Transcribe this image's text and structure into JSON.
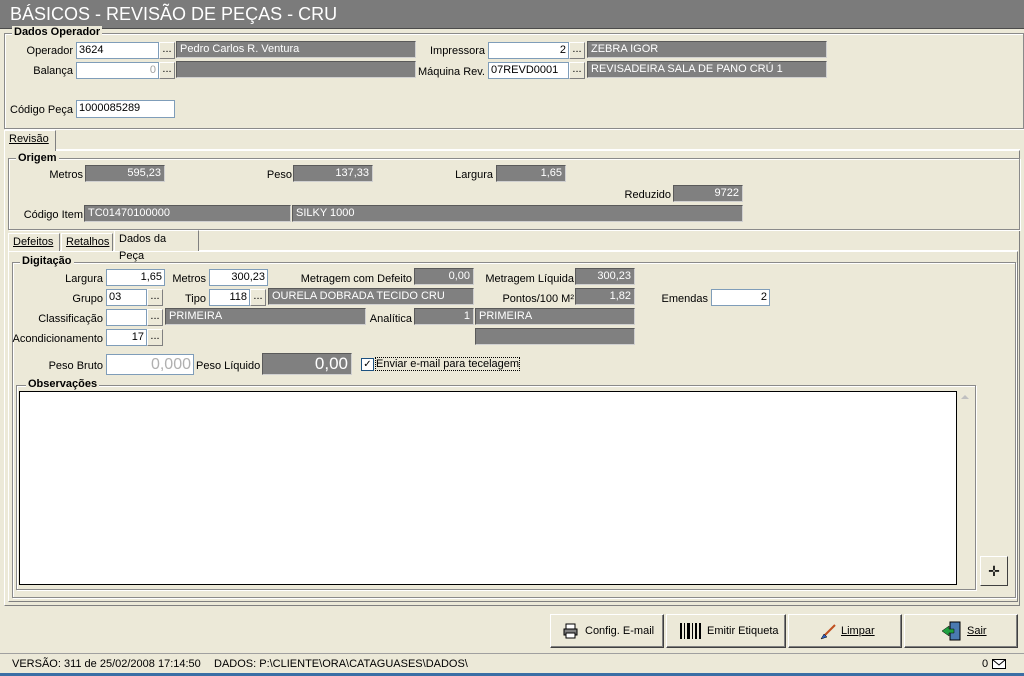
{
  "window": {
    "title": "BÁSICOS - REVISÃO DE PEÇAS - CRU"
  },
  "dados_operador": {
    "legend": "Dados Operador",
    "operador_label": "Operador",
    "operador_code": "3624",
    "operador_name": "Pedro Carlos R. Ventura",
    "balanca_label": "Balança",
    "balanca_value": "0",
    "balanca_desc": "",
    "impressora_label": "Impressora",
    "impressora_value": "2",
    "impressora_desc": "ZEBRA IGOR",
    "maquina_label": "Máquina Rev.",
    "maquina_value": "07REVD0001",
    "maquina_desc": "REVISADEIRA SALA DE PANO CRÚ 1",
    "codigo_peca_label": "Código Peça",
    "codigo_peca_value": "1000085289",
    "dots": "..."
  },
  "main_tabs": {
    "revisao": "Revisão"
  },
  "origem": {
    "legend": "Origem",
    "metros_label": "Metros",
    "metros_value": "595,23",
    "peso_label": "Peso",
    "peso_value": "137,33",
    "largura_label": "Largura",
    "largura_value": "1,65",
    "reduzido_label": "Reduzido",
    "reduzido_value": "9722",
    "codigo_item_label": "Código Item",
    "codigo_item_value": "TC01470100000",
    "item_desc": "SILKY 1000"
  },
  "sub_tabs": {
    "defeitos": "Defeitos",
    "retalhos": "Retalhos",
    "dados_peca": "Dados da Peça"
  },
  "digitacao": {
    "legend": "Digitação",
    "largura_label": "Largura",
    "largura_value": "1,65",
    "metros_label": "Metros",
    "metros_value": "300,23",
    "metragem_defeito_label": "Metragem com Defeito",
    "metragem_defeito_value": "0,00",
    "metragem_liquida_label": "Metragem Líquida",
    "metragem_liquida_value": "300,23",
    "grupo_label": "Grupo",
    "grupo_value": "03",
    "tipo_label": "Tipo",
    "tipo_value": "118",
    "tipo_desc": "OURELA DOBRADA TECIDO CRU",
    "pontos_label": "Pontos/100 M²",
    "pontos_value": "1,82",
    "emendas_label": "Emendas",
    "emendas_value": "2",
    "classificacao_label": "Classificação",
    "classificacao_value": "",
    "classificacao_desc": "PRIMEIRA",
    "analitica_label": "Analítica",
    "analitica_value": "1",
    "analitica_desc": "PRIMEIRA",
    "acondicionamento_label": "Acondicionamento",
    "acondicionamento_value": "17",
    "acondicionamento_desc": "",
    "peso_bruto_label": "Peso Bruto",
    "peso_bruto_value": "0,000",
    "peso_liquido_label": "Peso Líquido",
    "peso_liquido_value": "0,00",
    "email_checkbox_label": "Enviar e-mail para tecelagem",
    "email_checkbox_checked": true,
    "observacoes_legend": "Observações",
    "observacoes_text": ""
  },
  "buttons": {
    "config_email": "Config. E-mail",
    "emitir_etiqueta": "Emitir Etiqueta",
    "limpar": "Limpar",
    "sair": "Sair"
  },
  "status_bar": {
    "versao": "VERSÃO: 311 de 25/02/2008 17:14:50",
    "dados": "DADOS: P:\\CLIENTE\\ORA\\CATAGUASES\\DADOS\\",
    "mail_count": "0"
  }
}
